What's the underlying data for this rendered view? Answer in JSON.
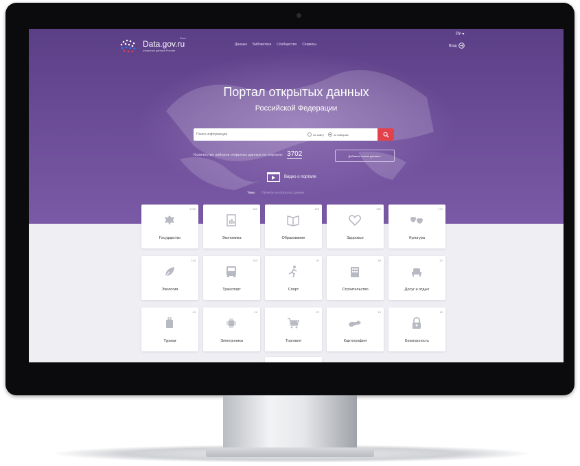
{
  "site": {
    "logo_title": "Data.gov.ru",
    "logo_subtitle": "открытые данные России",
    "logo_beta": "Бета",
    "language": "РУ",
    "login_label": "Вход"
  },
  "nav": {
    "items": [
      {
        "label": "Данные"
      },
      {
        "label": "Библиотека"
      },
      {
        "label": "Сообщество"
      },
      {
        "label": "Сервисы"
      }
    ]
  },
  "hero": {
    "title": "Портал открытых данных",
    "subtitle": "Российской Федерации"
  },
  "search": {
    "placeholder": "Поиск информации",
    "option_site": "по сайту",
    "option_datasets": "по наборам",
    "selected": "по наборам"
  },
  "stats": {
    "count_label": "Количество наборов открытых данных на портале:",
    "count_value": "3702",
    "suggest_label": "Добавить новые данные"
  },
  "video": {
    "label": "Видео о портале"
  },
  "tabs": {
    "active": "Темы",
    "other": "Проекты на открытых данных"
  },
  "categories": [
    {
      "label": "Государство",
      "count": "1785",
      "icon": "coat-of-arms-icon"
    },
    {
      "label": "Экономика",
      "count": "660",
      "icon": "document-chart-icon"
    },
    {
      "label": "Образование",
      "count": "425",
      "icon": "open-book-icon"
    },
    {
      "label": "Здоровье",
      "count": "285",
      "icon": "heart-icon"
    },
    {
      "label": "Культура",
      "count": "172",
      "icon": "theater-masks-icon"
    },
    {
      "label": "Экология",
      "count": "115",
      "icon": "leaf-icon"
    },
    {
      "label": "Транспорт",
      "count": "103",
      "icon": "bus-icon"
    },
    {
      "label": "Спорт",
      "count": "90",
      "icon": "runner-icon"
    },
    {
      "label": "Строительство",
      "count": "58",
      "icon": "building-icon"
    },
    {
      "label": "Досуг и отдых",
      "count": "32",
      "icon": "armchair-icon"
    },
    {
      "label": "Туризм",
      "count": "23",
      "icon": "suitcase-icon"
    },
    {
      "label": "Электроника",
      "count": "22",
      "icon": "chip-icon"
    },
    {
      "label": "Торговля",
      "count": "20",
      "icon": "shopping-cart-icon"
    },
    {
      "label": "Картография",
      "count": "10",
      "icon": "russia-map-icon"
    },
    {
      "label": "Безопасность",
      "count": "10",
      "icon": "padlock-icon"
    }
  ],
  "colors": {
    "hero_top": "#5b3f86",
    "hero_bottom": "#7a5aa6",
    "accent_red": "#e2424b",
    "icon_gray": "#b7b9c3"
  }
}
